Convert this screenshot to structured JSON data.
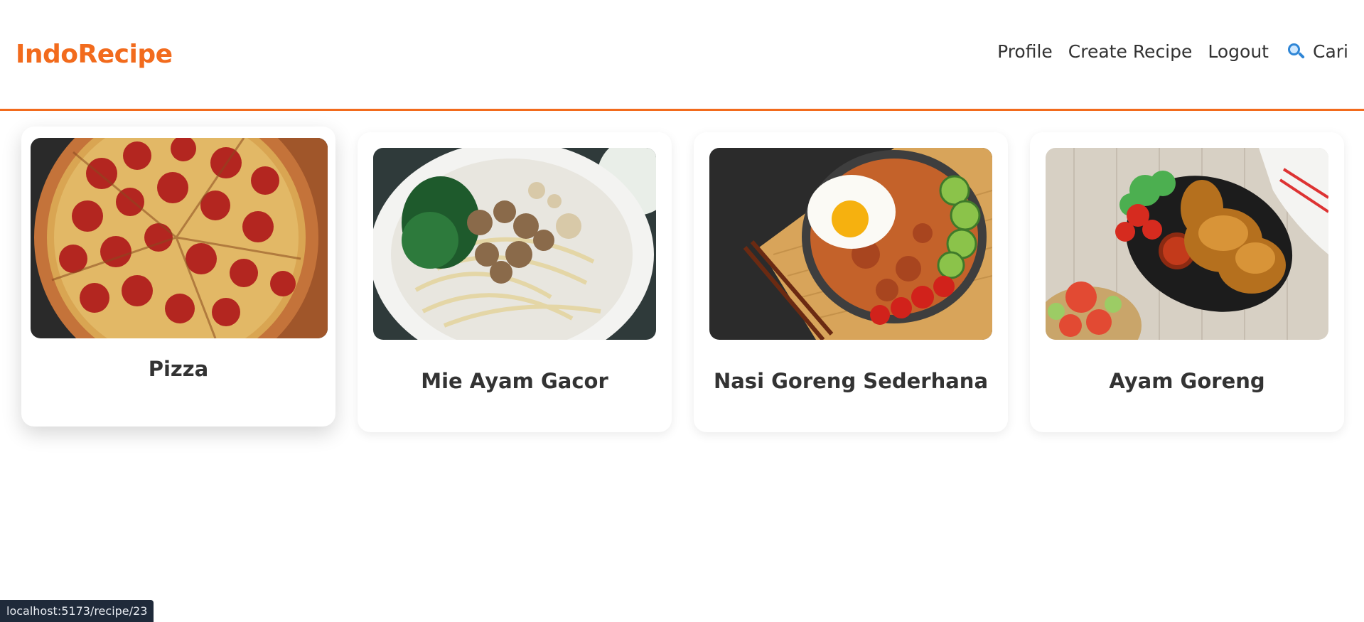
{
  "navbar": {
    "brand": "IndoRecipe",
    "links": [
      "Profile",
      "Create Recipe",
      "Logout"
    ],
    "search_label": "Cari",
    "search_icon": "search-icon"
  },
  "colors": {
    "accent": "#f26b1d",
    "text": "#333333",
    "status_bar_bg": "#1f2a3a"
  },
  "recipes": [
    {
      "title": "Pizza",
      "image": "pizza-photo"
    },
    {
      "title": "Mie Ayam Gacor",
      "image": "mie-ayam-photo"
    },
    {
      "title": "Nasi Goreng Sederhana",
      "image": "nasi-goreng-photo"
    },
    {
      "title": "Ayam Goreng",
      "image": "ayam-goreng-photo"
    }
  ],
  "status_bar": {
    "url": "localhost:5173/recipe/23"
  }
}
